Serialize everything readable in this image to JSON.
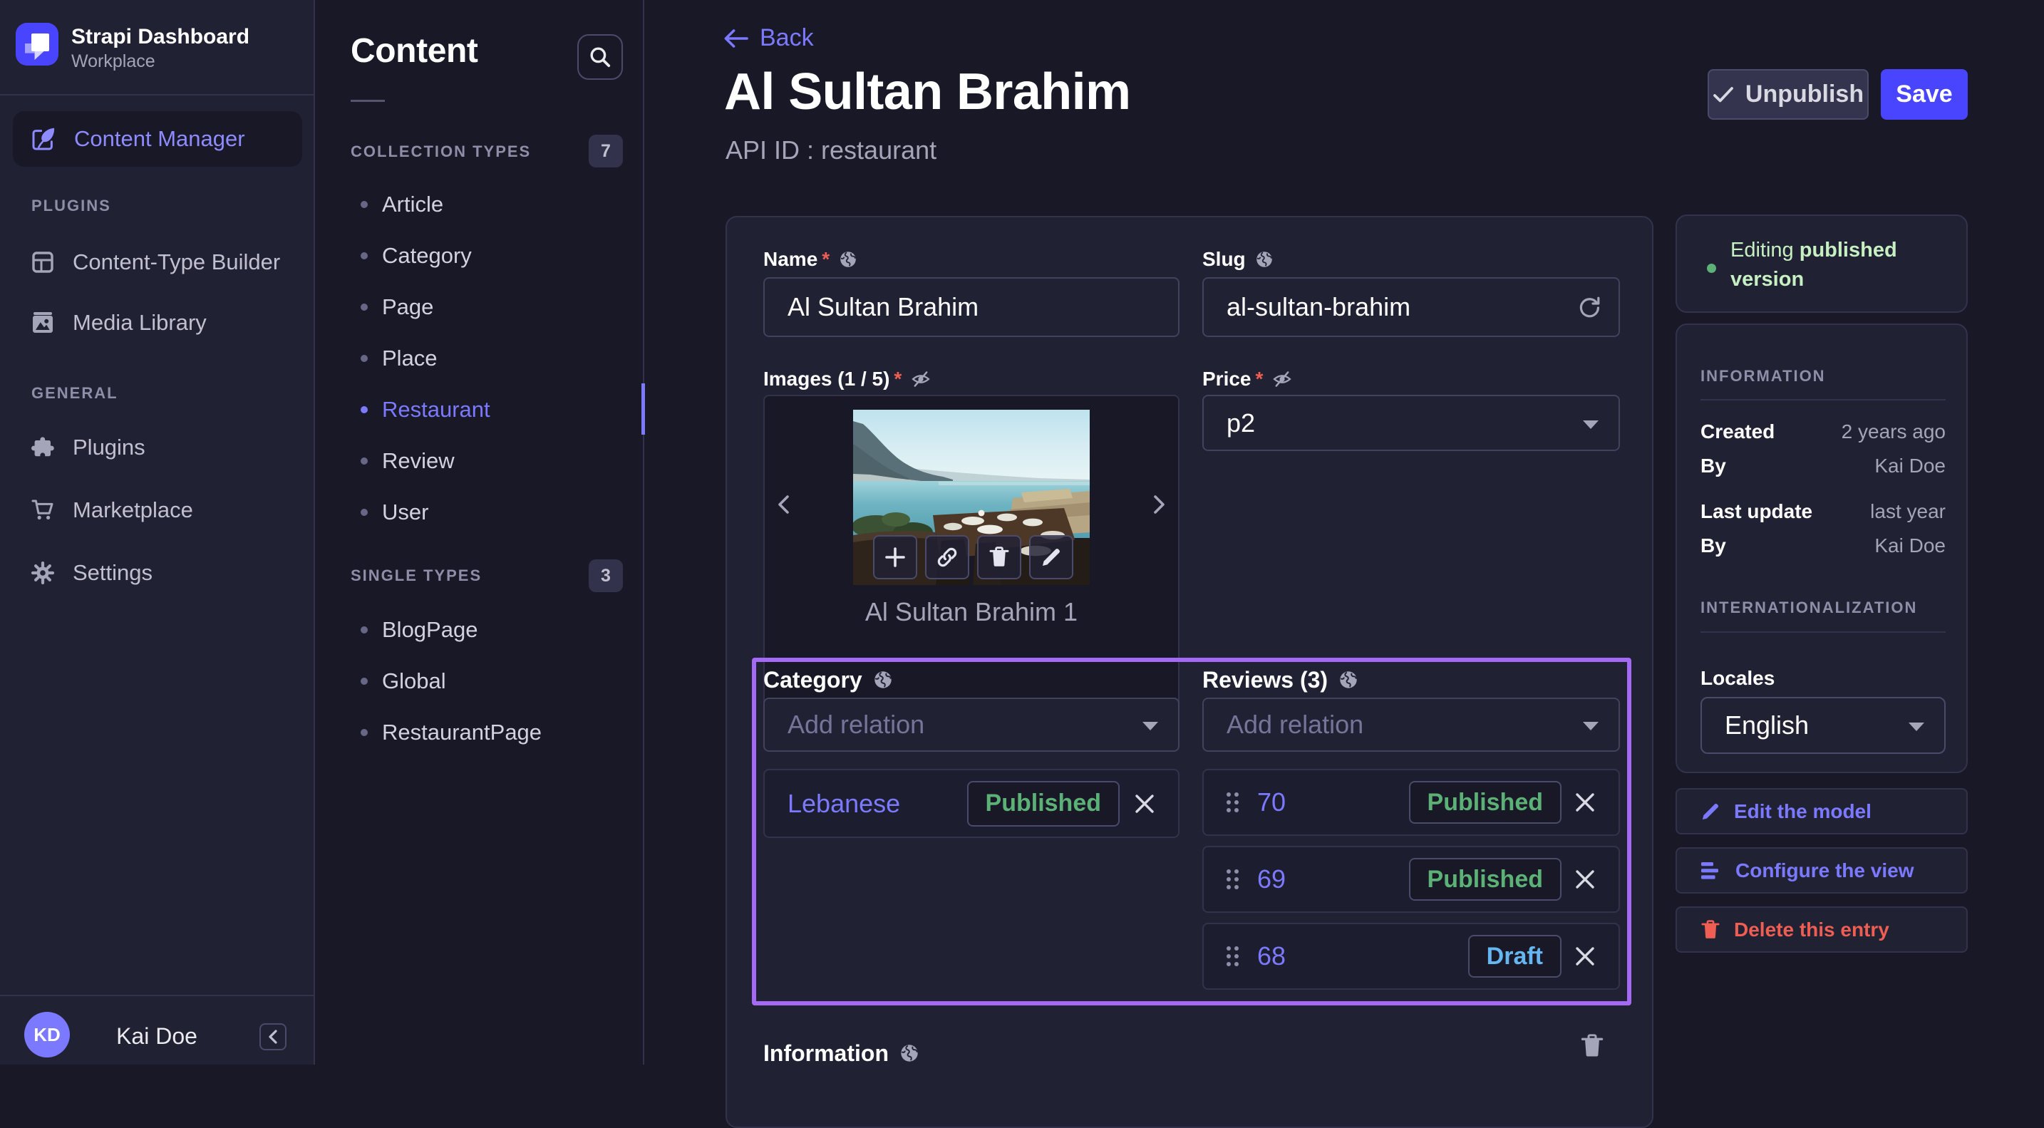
{
  "colors": {
    "primary": "#4945ff",
    "primary_light": "#7b79ff",
    "success": "#5cb176",
    "success_light": "#c6f0c2",
    "draft_blue": "#66b7f1",
    "danger": "#ee5e52",
    "highlight_outline": "#a46af5",
    "panel_bg": "#212134",
    "page_bg": "#181826"
  },
  "app": {
    "name": "Strapi Dashboard",
    "workspace": "Workplace",
    "user_initials": "KD",
    "user_name": "Kai Doe"
  },
  "left_menu": {
    "active_item": "Content Manager",
    "plugins_section": "PLUGINS",
    "plugins_items": [
      {
        "label": "Content-Type Builder"
      },
      {
        "label": "Media Library"
      }
    ],
    "general_section": "GENERAL",
    "general_items": [
      {
        "label": "Plugins"
      },
      {
        "label": "Marketplace"
      },
      {
        "label": "Settings"
      }
    ]
  },
  "subnav": {
    "title": "Content",
    "collection_label": "COLLECTION TYPES",
    "collection_count": "7",
    "collection_items": [
      {
        "label": "Article"
      },
      {
        "label": "Category"
      },
      {
        "label": "Page"
      },
      {
        "label": "Place"
      },
      {
        "label": "Restaurant"
      },
      {
        "label": "Review"
      },
      {
        "label": "User"
      }
    ],
    "single_label": "SINGLE TYPES",
    "single_count": "3",
    "single_items": [
      {
        "label": "BlogPage"
      },
      {
        "label": "Global"
      },
      {
        "label": "RestaurantPage"
      }
    ]
  },
  "header": {
    "back": "Back",
    "title": "Al Sultan Brahim",
    "api_id": "API ID : restaurant",
    "unpublish": "Unpublish",
    "save": "Save"
  },
  "form": {
    "name_label": "Name",
    "name_value": "Al Sultan Brahim",
    "slug_label": "Slug",
    "slug_value": "al-sultan-brahim",
    "images_label": "Images (1 / 5)",
    "image_caption": "Al Sultan Brahim 1",
    "price_label": "Price",
    "price_value": "p2",
    "category_label": "Category",
    "category_placeholder": "Add relation",
    "category_relation": {
      "name": "Lebanese",
      "status": "Published"
    },
    "reviews_label": "Reviews (3)",
    "reviews_placeholder": "Add relation",
    "review_relations": [
      {
        "name": "70",
        "status": "Published"
      },
      {
        "name": "69",
        "status": "Published"
      },
      {
        "name": "68",
        "status": "Draft"
      }
    ],
    "information_label": "Information"
  },
  "aside": {
    "status_prefix": "Editing ",
    "status_emphasis": "published version",
    "information_label": "INFORMATION",
    "info_rows": [
      {
        "k": "Created",
        "v": "2 years ago"
      },
      {
        "k": "By",
        "v": "Kai Doe"
      },
      {
        "k": "Last update",
        "v": "last year"
      },
      {
        "k": "By",
        "v": "Kai Doe"
      }
    ],
    "i18n_label": "INTERNATIONALIZATION",
    "locales_label": "Locales",
    "locale_value": "English",
    "action_edit": "Edit the model",
    "action_configure": "Configure the view",
    "action_delete": "Delete this entry"
  }
}
